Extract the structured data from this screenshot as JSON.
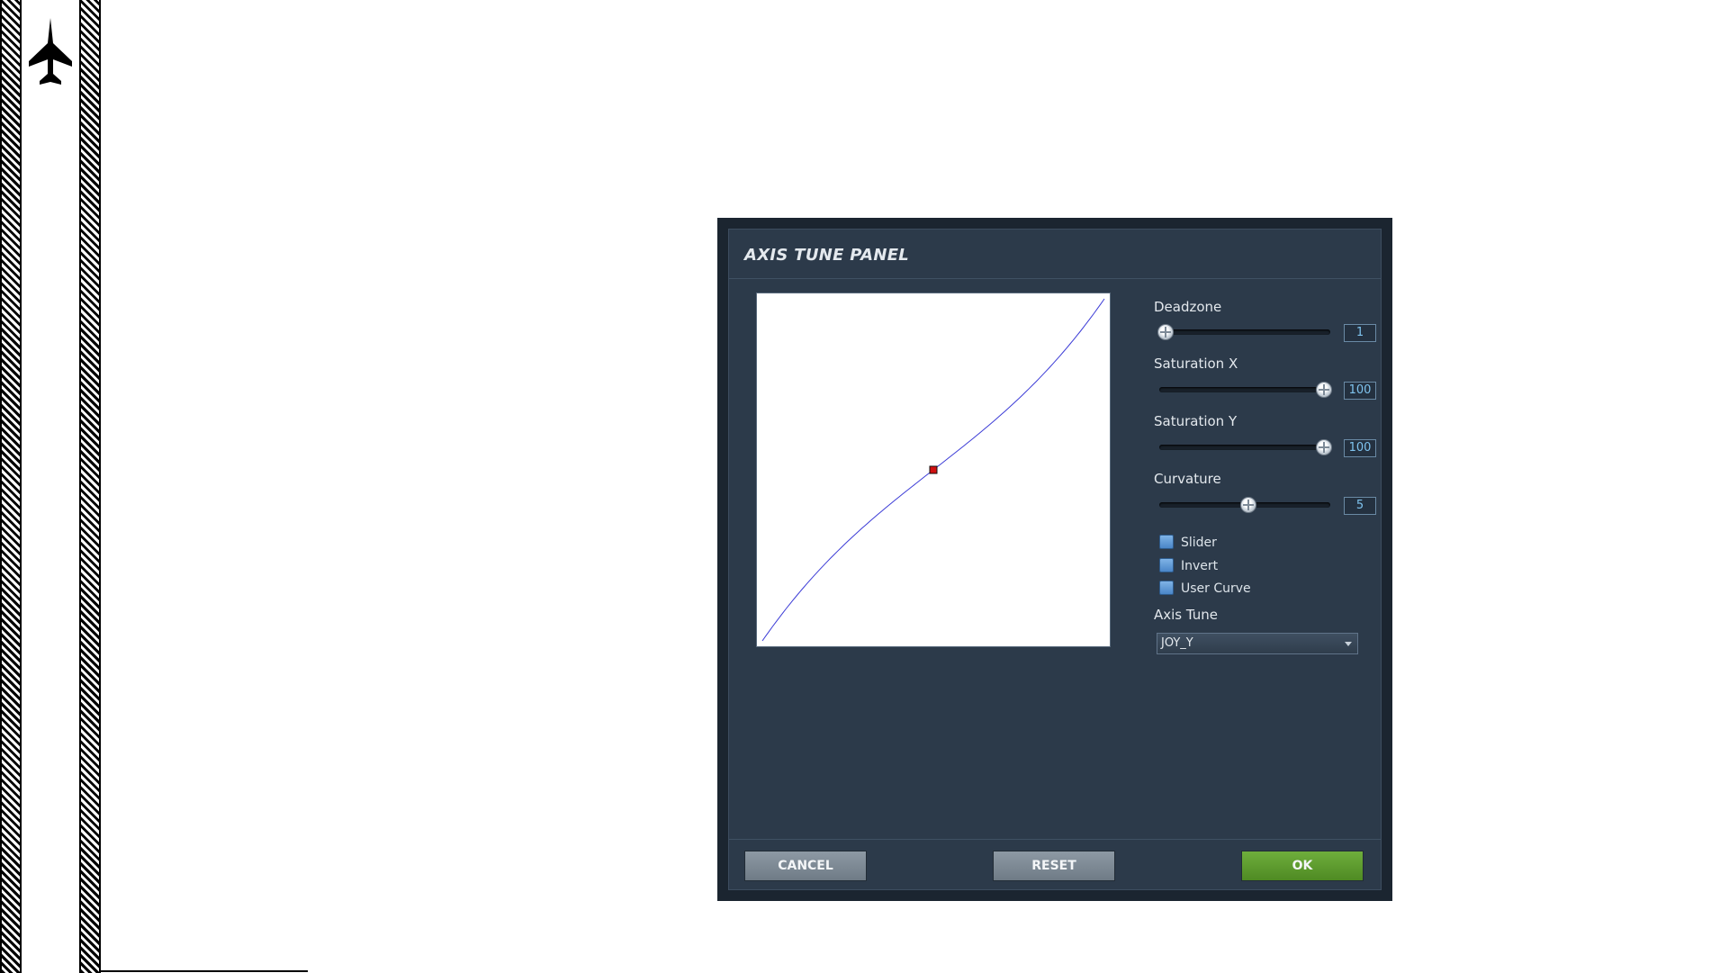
{
  "panel": {
    "title": "AXIS TUNE PANEL"
  },
  "controls": {
    "deadzone": {
      "label": "Deadzone",
      "value": "1",
      "level": 0.0
    },
    "saturation_x": {
      "label": "Saturation X",
      "value": "100",
      "level": 1.0
    },
    "saturation_y": {
      "label": "Saturation Y",
      "value": "100",
      "level": 1.0
    },
    "curvature": {
      "label": "Curvature",
      "value": "5",
      "level": 0.52
    }
  },
  "options": {
    "slider": {
      "label": "Slider",
      "checked": false
    },
    "invert": {
      "label": "Invert",
      "checked": false
    },
    "user_curve": {
      "label": "User Curve",
      "checked": false
    }
  },
  "axis_tune": {
    "label": "Axis Tune",
    "selected": "JOY_Y"
  },
  "buttons": {
    "cancel": "CANCEL",
    "reset": "RESET",
    "ok": "OK"
  },
  "colors": {
    "curve": "#3b3bd6",
    "center_point": "#d01010",
    "ok_green": "#5f9d2e",
    "value_text": "#7fc3ee"
  },
  "icons": {
    "side_bar": "fighter-jet-icon"
  }
}
